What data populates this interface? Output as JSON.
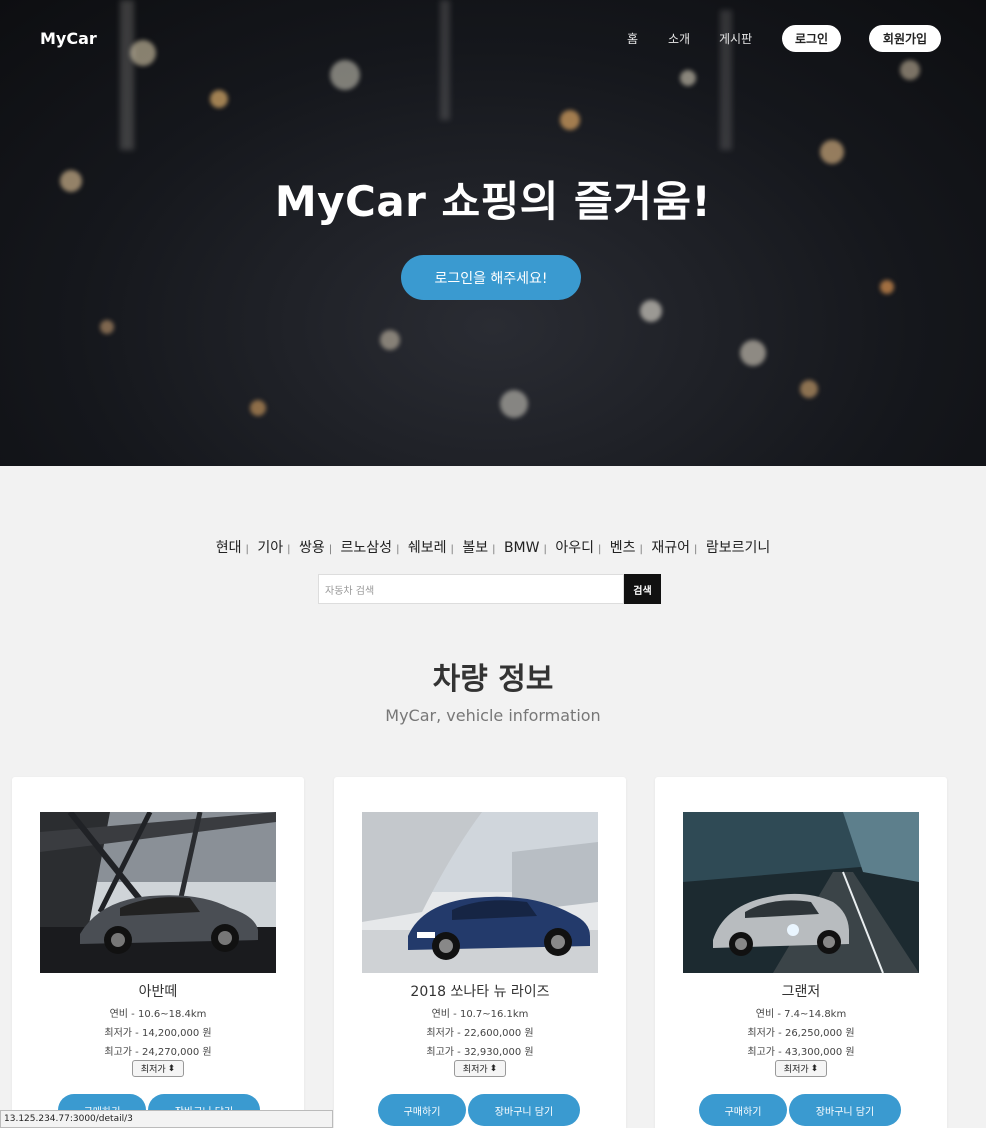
{
  "nav": {
    "logo": "MyCar",
    "links": [
      "홈",
      "소개",
      "게시판"
    ],
    "login": "로그인",
    "signup": "회원가입"
  },
  "hero": {
    "title": "MyCar 쇼핑의 즐거움!",
    "cta": "로그인을 해주세요!"
  },
  "brands": [
    "현대",
    "기아",
    "쌍용",
    "르노삼성",
    "쉐보레",
    "볼보",
    "BMW",
    "아우디",
    "벤츠",
    "재규어",
    "람보르기니"
  ],
  "search": {
    "placeholder": "자동차 검색",
    "button": "검색"
  },
  "section": {
    "title": "차량 정보",
    "subtitle": "MyCar, vehicle information"
  },
  "cars": [
    {
      "name": "아반떼",
      "mileage": "연비 - 10.6~18.4km",
      "min_price": "최저가 - 14,200,000 원",
      "max_price": "최고가 - 24,270,000 원",
      "sort": "최저가",
      "buy": "구매하기",
      "cart": "장바구니 담기"
    },
    {
      "name": "2018 쏘나타 뉴 라이즈",
      "mileage": "연비 - 10.7~16.1km",
      "min_price": "최저가 - 22,600,000 원",
      "max_price": "최고가 - 32,930,000 원",
      "sort": "최저가",
      "buy": "구매하기",
      "cart": "장바구니 담기"
    },
    {
      "name": "그랜저",
      "mileage": "연비 - 7.4~14.8km",
      "min_price": "최저가 - 26,250,000 원",
      "max_price": "최고가 - 43,300,000 원",
      "sort": "최저가",
      "buy": "구매하기",
      "cart": "장바구니 담기"
    }
  ],
  "status_url": "13.125.234.77:3000/detail/3"
}
